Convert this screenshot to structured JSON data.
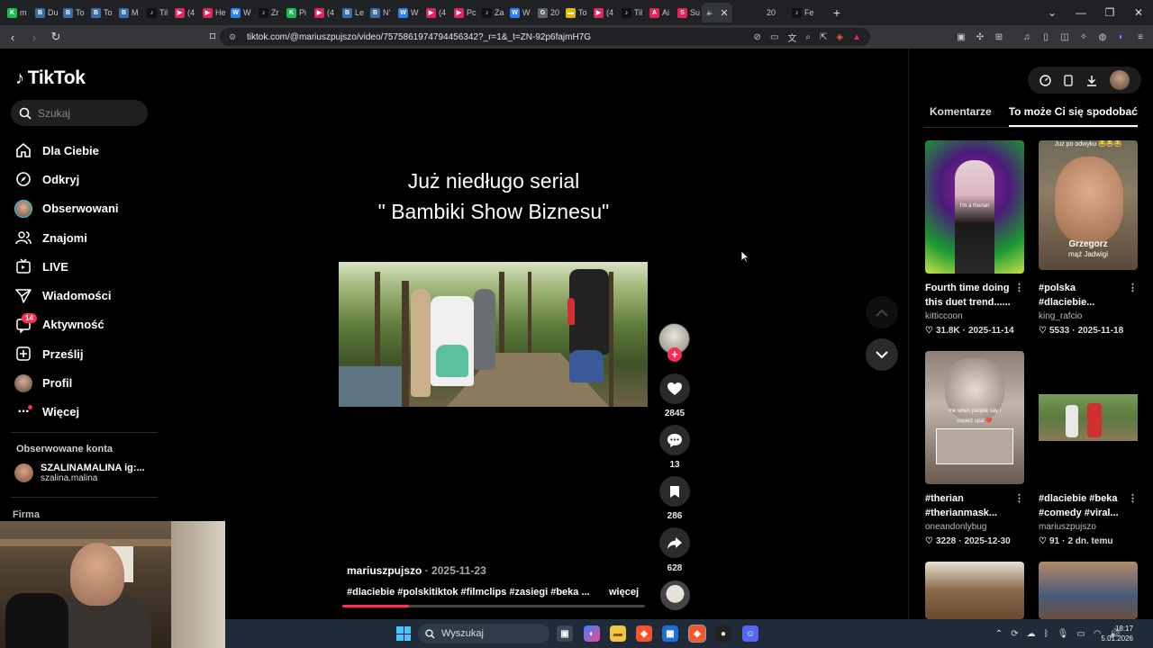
{
  "browser": {
    "tabs": [
      {
        "label": "m",
        "color": "#1db954",
        "glyph": "K"
      },
      {
        "label": "Du",
        "color": "#3a6ea5",
        "glyph": "B"
      },
      {
        "label": "To",
        "color": "#3a6ea5",
        "glyph": "B"
      },
      {
        "label": "To",
        "color": "#3a6ea5",
        "glyph": "B"
      },
      {
        "label": "M",
        "color": "#3a6ea5",
        "glyph": "B"
      },
      {
        "label": "Til",
        "color": "#111111",
        "glyph": "♪"
      },
      {
        "label": "(4",
        "color": "#e0245e",
        "glyph": "▶"
      },
      {
        "label": "He",
        "color": "#e0245e",
        "glyph": "▶"
      },
      {
        "label": "W",
        "color": "#2f80ed",
        "glyph": "W"
      },
      {
        "label": "Zr",
        "color": "#111111",
        "glyph": "♪"
      },
      {
        "label": "Pi",
        "color": "#1db954",
        "glyph": "K"
      },
      {
        "label": "(4",
        "color": "#e0245e",
        "glyph": "▶"
      },
      {
        "label": "Le",
        "color": "#3a6ea5",
        "glyph": "B"
      },
      {
        "label": "N'",
        "color": "#3a6ea5",
        "glyph": "B"
      },
      {
        "label": "W",
        "color": "#2f80ed",
        "glyph": "W"
      },
      {
        "label": "(4",
        "color": "#e0245e",
        "glyph": "▶"
      },
      {
        "label": "Pc",
        "color": "#e0245e",
        "glyph": "▶"
      },
      {
        "label": "Za",
        "color": "#111111",
        "glyph": "♪"
      },
      {
        "label": "W",
        "color": "#2f80ed",
        "glyph": "W"
      },
      {
        "label": "20",
        "color": "#5f6368",
        "glyph": "G"
      },
      {
        "label": "To",
        "color": "#e6b800",
        "glyph": "▬"
      },
      {
        "label": "(4",
        "color": "#e0245e",
        "glyph": "▶"
      },
      {
        "label": "Til",
        "color": "#111111",
        "glyph": "♪"
      },
      {
        "label": "Ai",
        "color": "#e0245e",
        "glyph": "A"
      },
      {
        "label": "Su",
        "color": "#e0245e",
        "glyph": "S"
      }
    ],
    "active_tab_icon": "speaker-icon",
    "extra_tab_label": "20",
    "extra_tab2_label": "Fe",
    "url": "tiktok.com/@mariuszpujszo/video/7575861974794456342?_r=1&_t=ZN-92p6fajmH7G"
  },
  "sidebar": {
    "logo": "TikTok",
    "search_placeholder": "Szukaj",
    "nav": [
      {
        "label": "Dla Ciebie",
        "icon": "home-icon"
      },
      {
        "label": "Odkryj",
        "icon": "compass-icon"
      },
      {
        "label": "Obserwowani",
        "icon": "avatar-icon"
      },
      {
        "label": "Znajomi",
        "icon": "friends-icon"
      },
      {
        "label": "LIVE",
        "icon": "live-icon"
      },
      {
        "label": "Wiadomości",
        "icon": "messages-icon"
      },
      {
        "label": "Aktywność",
        "icon": "activity-icon",
        "badge": "14"
      },
      {
        "label": "Prześlij",
        "icon": "upload-icon"
      },
      {
        "label": "Profil",
        "icon": "profile-icon"
      },
      {
        "label": "Więcej",
        "icon": "more-icon"
      }
    ],
    "followed_title": "Obserwowane konta",
    "followed": {
      "name": "SZALINAMALINA ig:...",
      "handle": "szalina.malina"
    },
    "footer_label": "Firma"
  },
  "video": {
    "title_line1": "Już niedługo serial",
    "title_line2": "\" Bambiki Show Biznesu\"",
    "likes": "2845",
    "comments": "13",
    "saves": "286",
    "shares": "628",
    "author": "mariuszpujszo",
    "date": "2025-11-23",
    "description": "#dlaciebie #polskitiktok #filmclips #zasiegi #beka ...",
    "more_label": "więcej",
    "progress": 0.22,
    "accent": "#fe2c55"
  },
  "right_panel": {
    "tabs": [
      "Komentarze",
      "To może Ci się spodobać"
    ],
    "active_tab": "To może Ci się spodobać",
    "cards": [
      {
        "title_l1": "Fourth time doing",
        "title_l2": "this duet trend......",
        "user": "kitticcoon",
        "likes": "31.8K",
        "date": "2025-11-14",
        "thumb_text": "I'm a therian"
      },
      {
        "title_l1": "#polska",
        "title_l2": "#dlaciebie...",
        "user": "king_rafcio",
        "likes": "5533",
        "date": "2025-11-18",
        "thumb_text": "Grzegorz",
        "thumb_text2": "mąż Jadwigi",
        "thumb_top": "Już po odwyku 😂😂😂"
      },
      {
        "title_l1": "#therian",
        "title_l2": "#therianmask...",
        "user": "oneandonlybug",
        "likes": "3228",
        "date": "2025-12-30",
        "thumb_text": "me when people say i",
        "thumb_text2": "copied opal 💔"
      },
      {
        "title_l1": "#dlaciebie #beka",
        "title_l2": "#comedy #viral...",
        "user": "mariuszpujszo",
        "likes": "91",
        "date": "2 dn. temu"
      }
    ]
  },
  "taskbar": {
    "search_label": "Wyszukaj",
    "time": "18:17",
    "date": "5.01.2026"
  }
}
